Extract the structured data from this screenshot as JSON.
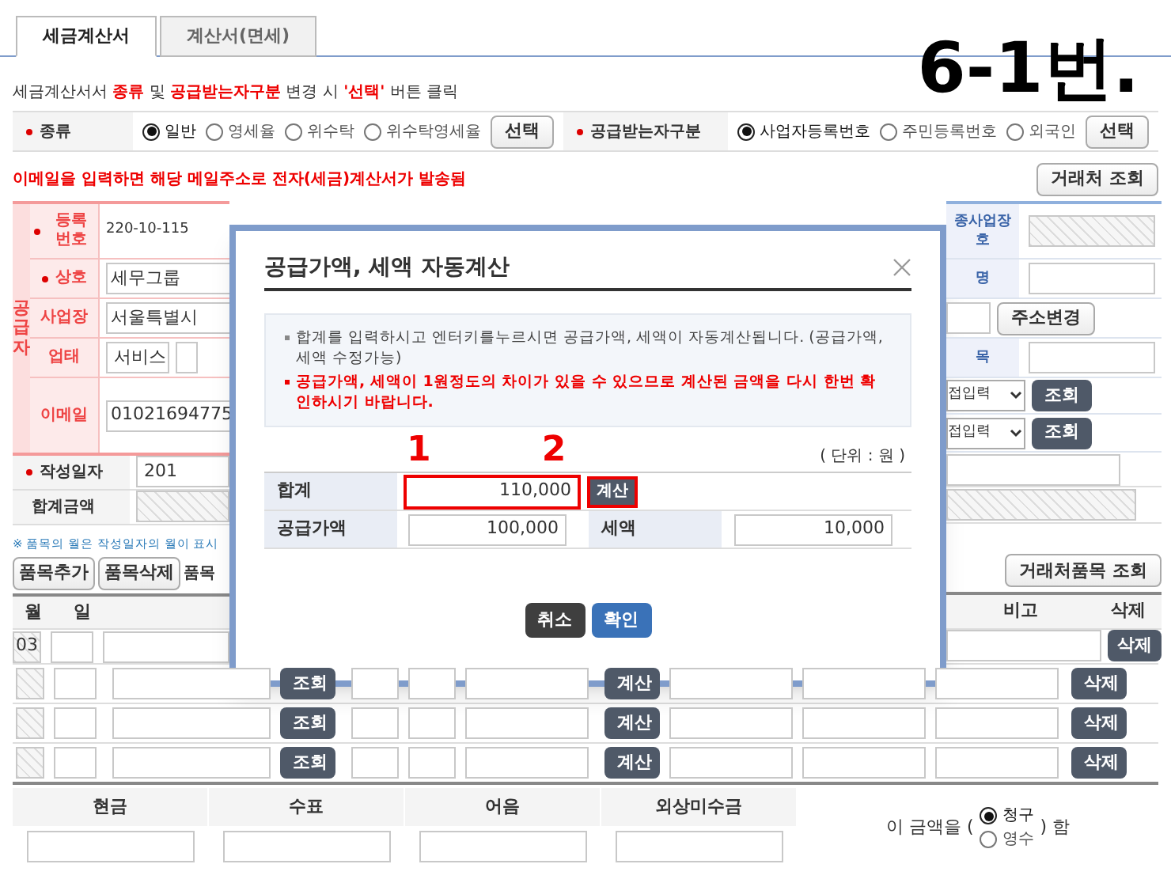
{
  "tabs": [
    {
      "label": "세금계산서",
      "selected": true
    },
    {
      "label": "계산서(면세)",
      "selected": false
    }
  ],
  "annotation": "6-1번.",
  "notice": "세금계산서서 **종류** 및 **공급받는자구분** 변경 시 **'선택'** 버튼 클릭",
  "type_rows": [
    {
      "label": "종류",
      "required": true,
      "options": [
        {
          "label": "일반",
          "selected": true
        },
        {
          "label": "영세율",
          "selected": false
        },
        {
          "label": "위수탁",
          "selected": false
        },
        {
          "label": "위수탁영세율",
          "selected": false
        }
      ],
      "button": "선택"
    },
    {
      "label": "공급받는자구분",
      "required": true,
      "options": [
        {
          "label": "사업자등록번호",
          "selected": true
        },
        {
          "label": "주민등록번호",
          "selected": false
        },
        {
          "label": "외국인",
          "selected": false
        }
      ],
      "button": "선택"
    }
  ],
  "email_notice": "이메일을 입력하면 해당 메일주소로 전자(세금)계산서가 발송됨",
  "partner_button": "거래처 조회",
  "supplier": {
    "group_label": "공급자",
    "rows": [
      {
        "label": "등록 번호",
        "required": true,
        "kind": "text",
        "value": "220-10-115"
      },
      {
        "label": "상호",
        "required": true,
        "kind": "input",
        "value": "세무그룹"
      },
      {
        "label": "사업장",
        "required": false,
        "kind": "input",
        "value": "서울특별시"
      },
      {
        "label": "업태",
        "required": false,
        "kind": "double",
        "value": "서비스"
      },
      {
        "label": "이메일",
        "required": false,
        "kind": "input",
        "value": "01021694775"
      }
    ]
  },
  "date_row": {
    "label": "작성일자",
    "required": true,
    "value": "201"
  },
  "total_row": {
    "label": "합계금액",
    "required": false
  },
  "items_note": "※ 품목의 월은 작성일자의 월이 표시",
  "item_buttons": [
    "품목추가",
    "품목삭제"
  ],
  "items_fragment": "품목",
  "table_left_headers": [
    "월",
    "일"
  ],
  "first_row_month": "03",
  "receiver_right": {
    "rows": [
      {
        "kind": "label_hatched",
        "label": "종사업장",
        "label2": "호"
      },
      {
        "kind": "label_input",
        "label": "명"
      },
      {
        "kind": "input_button",
        "button": "주소변경"
      },
      {
        "kind": "label_input",
        "label": "목"
      },
      {
        "kind": "select_button",
        "value": "접입력",
        "button": "조회"
      },
      {
        "kind": "select_button",
        "value": "접입력",
        "button": "조회"
      }
    ]
  },
  "item_lookup_button": "거래처품목 조회",
  "table_right_headers": [
    "비고",
    "삭제"
  ],
  "first_row_delete": "삭제",
  "item_rows": [
    {
      "lookup": "조회",
      "calc": "계산",
      "delete": "삭제"
    },
    {
      "lookup": "조회",
      "calc": "계산",
      "delete": "삭제"
    },
    {
      "lookup": "조회",
      "calc": "계산",
      "delete": "삭제"
    }
  ],
  "modal": {
    "title": "공급가액, 세액 자동계산",
    "info": [
      {
        "kind": "normal",
        "text": "합계를 입력하시고 엔터키를누르시면 공급가액, 세액이 자동계산됩니다. (공급가액, 세액 수정가능)"
      },
      {
        "kind": "warning",
        "text": "공급가액, 세액이 1원정도의 차이가 있을 수 있으므로 계산된 금액을 다시 한번 확인하시기 바랍니다."
      }
    ],
    "unit": "( 단위 : 원 )",
    "markers": [
      "1",
      "2"
    ],
    "total_label": "합계",
    "total_value": "110,000",
    "calc_button": "계산",
    "supply_label": "공급가액",
    "supply_value": "100,000",
    "tax_label": "세액",
    "tax_value": "10,000",
    "cancel": "취소",
    "confirm": "확인"
  },
  "payment": {
    "headers": [
      "현금",
      "수표",
      "어음",
      "외상미수금"
    ],
    "prefix": "이 금액을 (",
    "options": [
      {
        "label": "청구",
        "selected": true
      },
      {
        "label": "영수",
        "selected": false
      }
    ],
    "suffix": ") 함"
  }
}
